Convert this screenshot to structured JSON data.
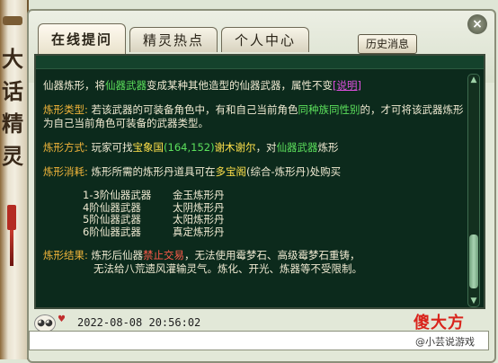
{
  "scroll": {
    "title": "大话精灵"
  },
  "window": {
    "close_glyph": "×"
  },
  "tabs": [
    {
      "label": "在线提问"
    },
    {
      "label": "精灵热点"
    },
    {
      "label": "个人中心"
    }
  ],
  "history_button": "历史消息",
  "answer": {
    "intro": {
      "pre": "仙器炼形，将",
      "hl": "仙器武器",
      "post": "变成某种其他造型的仙器武器，属性不变",
      "link": "[说明]"
    },
    "type": {
      "key": "炼形类型:",
      "text1": "若该武器的可装备角色中，有和自己当前角色",
      "hl": "同种族同性别",
      "text2": "的，才可将该武器炼形为自己当前角色可装备的武器类型。"
    },
    "method": {
      "key": "炼形方式:",
      "pre": "玩家可找",
      "npc": "宝象国",
      "coords": "(164,152)",
      "name": "谢木谢尔",
      "mid": "，对",
      "hl": "仙器武器",
      "post": "炼形"
    },
    "consume": {
      "key": "炼形消耗:",
      "text1": "炼形所需的炼形丹道具可在",
      "place": "多宝阁",
      "text2": "(综合-炼形丹)处购买"
    },
    "table": [
      {
        "tier": "1-3阶仙器武器",
        "item": "金玉炼形丹"
      },
      {
        "tier": "4阶仙器武器",
        "item": "太阴炼形丹"
      },
      {
        "tier": "5阶仙器武器",
        "item": "太阳炼形丹"
      },
      {
        "tier": "6阶仙器武器",
        "item": "真定炼形丹"
      }
    ],
    "result": {
      "key": "炼形结果:",
      "pre": "炼形后仙器",
      "warn": "禁止交易",
      "text1": "，无法使用霉梦石、高级霉梦石重铸，",
      "text2": "无法给八荒遗风灌输灵气。炼化、开光、炼器等不受限制。"
    }
  },
  "timestamp": "2022-08-08  20:56:02",
  "watermark": {
    "logo": "傻大方",
    "author": "@小芸说游戏"
  },
  "colors": {
    "chat_bg": "#0c2a1c",
    "key": "#f0b43a",
    "green": "#5ce05c",
    "yellow": "#ffe14a",
    "red": "#ff5a4a",
    "magenta": "#e050e0"
  }
}
